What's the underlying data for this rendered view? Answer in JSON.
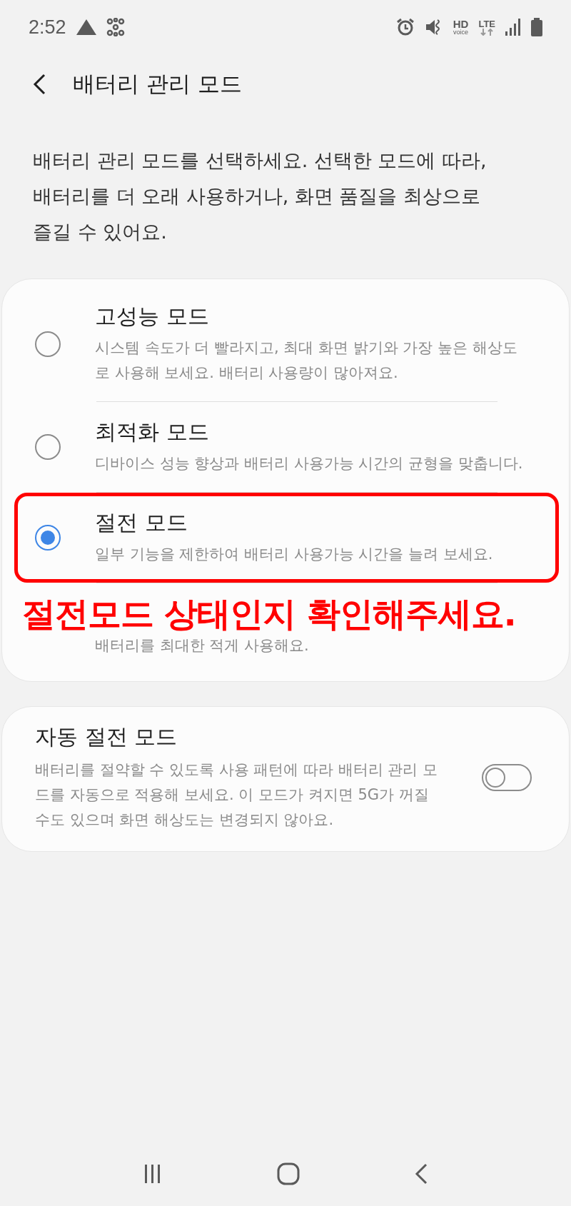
{
  "status_bar": {
    "time": "2:52",
    "lte": "LTE",
    "hd": "HD",
    "voice": "voice"
  },
  "header": {
    "title": "배터리 관리 모드"
  },
  "description": "배터리 관리 모드를 선택하세요. 선택한 모드에 따라, 배터리를 더 오래 사용하거나, 화면 품질을 최상으로 즐길 수 있어요.",
  "modes": [
    {
      "title": "고성능 모드",
      "subtitle": "시스템 속도가 더 빨라지고, 최대 화면 밝기와 가장 높은 해상도로 사용해 보세요. 배터리 사용량이 많아져요.",
      "selected": false,
      "highlighted": false
    },
    {
      "title": "최적화 모드",
      "subtitle": "디바이스 성능 향상과 배터리 사용가능 시간의 균형을 맞춥니다.",
      "selected": false,
      "highlighted": false
    },
    {
      "title": "절전 모드",
      "subtitle": "일부 기능을 제한하여 배터리 사용가능 시간을 늘려 보세요.",
      "selected": true,
      "highlighted": true
    },
    {
      "subtitle": "배터리를 최대한 적게 사용해요.",
      "highlighted": false
    }
  ],
  "auto_power_saving": {
    "title": "자동 절전 모드",
    "subtitle": "배터리를 절약할 수 있도록 사용 패턴에 따라 배터리 관리 모드를 자동으로 적용해 보세요. 이 모드가 켜지면 5G가 꺼질 수도 있으며 화면 해상도는 변경되지 않아요.",
    "on": false
  },
  "annotation": {
    "text": "절전모드 상태인지 확인해주세요."
  }
}
